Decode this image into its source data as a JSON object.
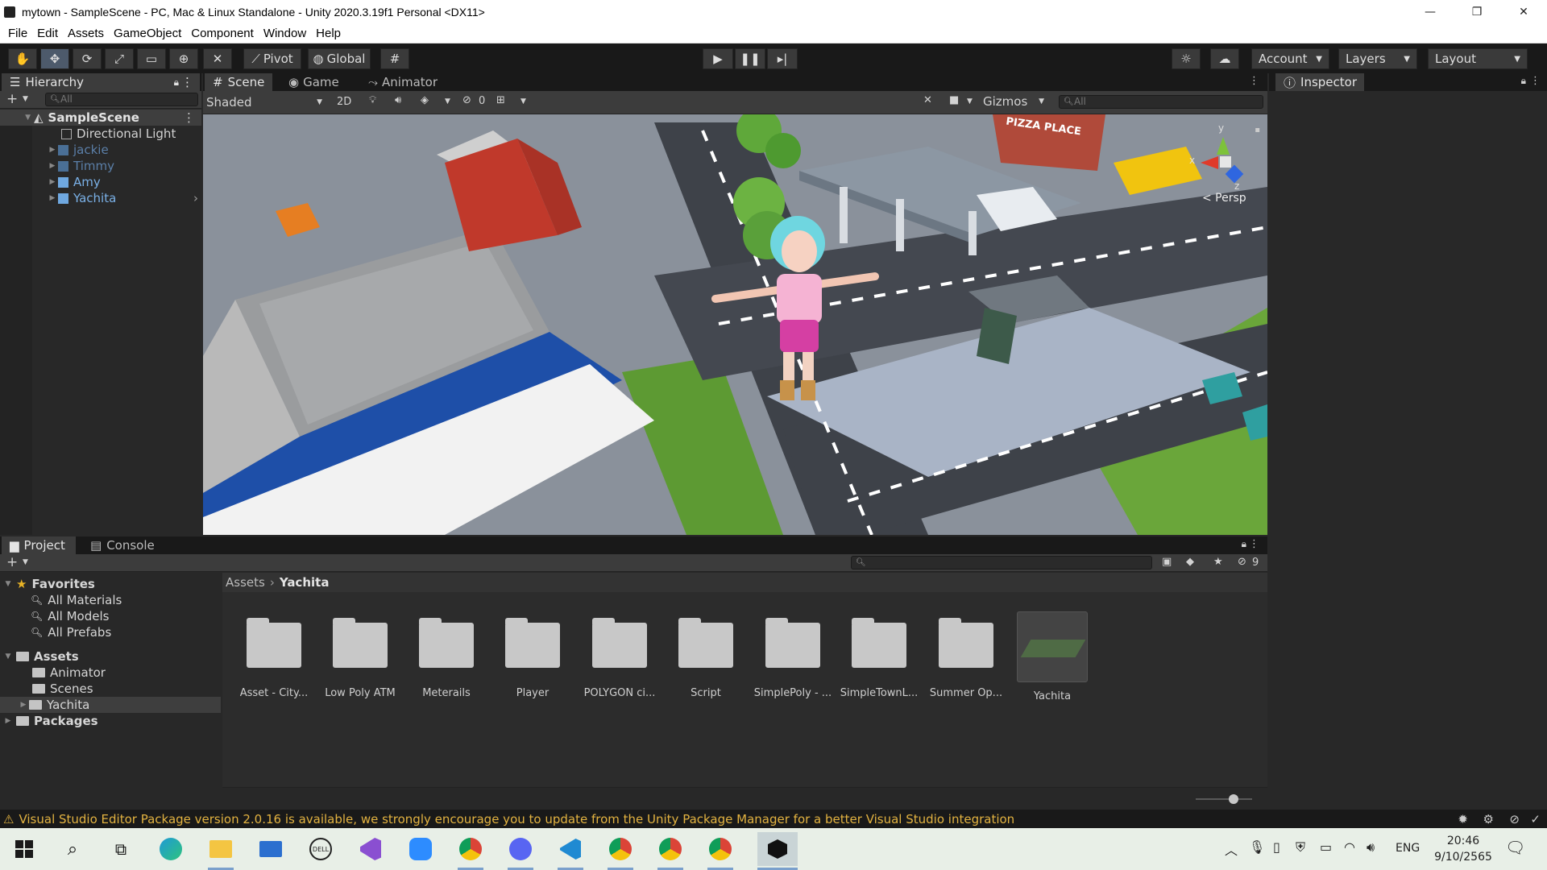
{
  "window": {
    "title": "mytown - SampleScene - PC, Mac & Linux Standalone - Unity 2020.3.19f1 Personal <DX11>",
    "minimize": "—",
    "maximize": "❐",
    "close": "✕"
  },
  "menu": [
    "File",
    "Edit",
    "Assets",
    "GameObject",
    "Component",
    "Window",
    "Help"
  ],
  "toolbar": {
    "pivot": "Pivot",
    "global": "Global",
    "account": "Account",
    "layers": "Layers",
    "layout": "Layout"
  },
  "hierarchy": {
    "tab": "Hierarchy",
    "search_placeholder": "All",
    "scene": "SampleScene",
    "items": [
      {
        "label": "Directional Light",
        "color": "#d2d2d2"
      },
      {
        "label": "jackie",
        "color": "#5b7fa8"
      },
      {
        "label": "Timmy",
        "color": "#5b7fa8"
      },
      {
        "label": "Amy",
        "color": "#7ab0e6"
      },
      {
        "label": "Yachita",
        "color": "#7ab0e6"
      }
    ]
  },
  "scene": {
    "tabs": [
      "Scene",
      "Game",
      "Animator"
    ],
    "shading": "Shaded",
    "mode2d": "2D",
    "hidden_count": "0",
    "gizmos": "Gizmos",
    "search_placeholder": "All",
    "gizmo_y": "y",
    "gizmo_x": "x",
    "gizmo_z": "z",
    "persp": "< Persp",
    "signs": [
      "PIZZA PLACE"
    ]
  },
  "inspector": {
    "tab": "Inspector"
  },
  "project": {
    "tabs": [
      "Project",
      "Console"
    ],
    "favorites": "Favorites",
    "favorite_items": [
      "All Materials",
      "All Models",
      "All Prefabs"
    ],
    "assets_label": "Assets",
    "asset_folders": [
      "Animator",
      "Scenes",
      "Yachita"
    ],
    "packages": "Packages",
    "breadcrumb": [
      "Assets",
      "Yachita"
    ],
    "hidden_count": "9",
    "items": [
      "Asset - City...",
      "Low Poly ATM",
      "Meterails",
      "Player",
      "POLYGON ci...",
      "Script",
      "SimplePoly - ...",
      "SimpleTownL...",
      "Summer Op...",
      "Yachita"
    ]
  },
  "status": {
    "message": "Visual Studio Editor Package version 2.0.16 is available, we strongly encourage you to update from the Unity Package Manager for a better Visual Studio integration"
  },
  "taskbar": {
    "lang": "ENG",
    "time": "20:46",
    "date": "9/10/2565",
    "icons": [
      "start-icon",
      "search-icon",
      "task-view-icon",
      "edge-icon",
      "file-explorer-icon",
      "mail-icon",
      "dell-icon",
      "visual-studio-icon",
      "zoom-icon",
      "chrome-icon",
      "discord-icon",
      "vscode-icon",
      "chrome-profile-icon",
      "chrome-profile-2-icon",
      "chrome-3-icon",
      "unity-icon"
    ]
  }
}
